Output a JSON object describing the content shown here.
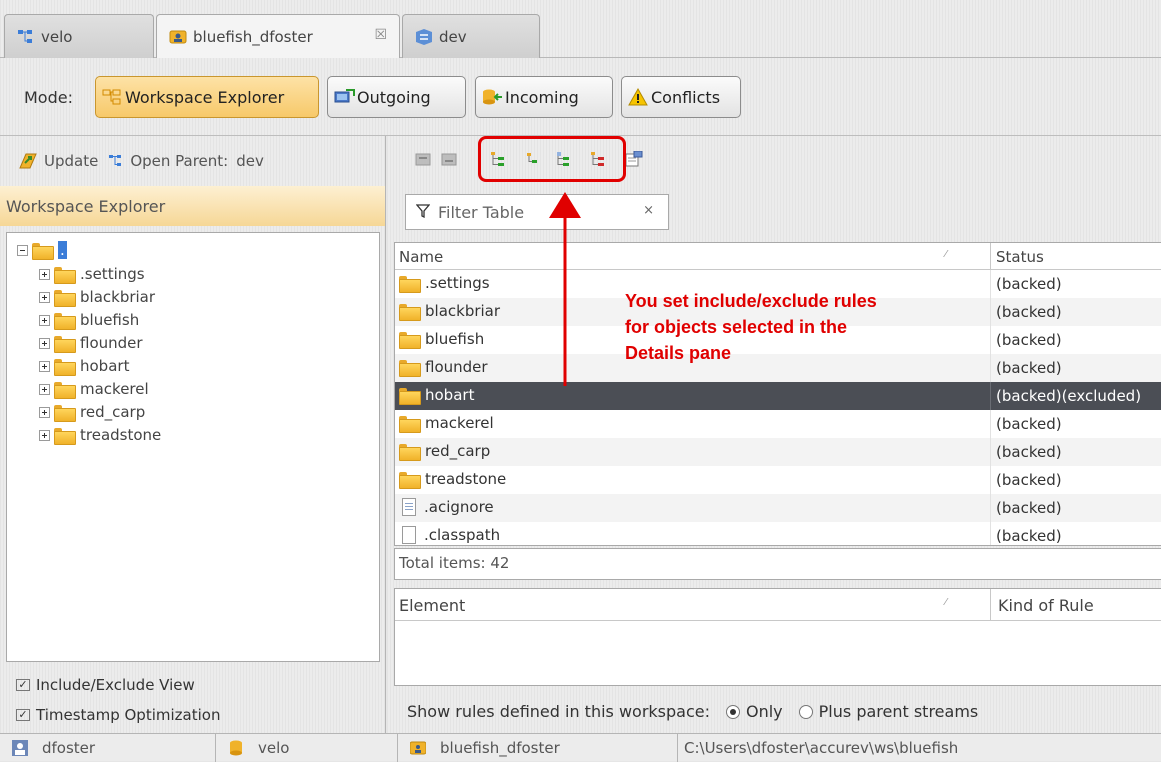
{
  "tabs": [
    {
      "label": "velo",
      "icon": "stream-tree-icon"
    },
    {
      "label": "bluefish_dfoster",
      "icon": "workspace-icon",
      "close": "☒"
    },
    {
      "label": "dev",
      "icon": "depot-stream-icon"
    }
  ],
  "mode_bar": {
    "label": "Mode:",
    "buttons": [
      {
        "label": "Workspace Explorer",
        "icon": "workspace-explorer-icon",
        "active": true
      },
      {
        "label": "Outgoing",
        "icon": "outgoing-icon"
      },
      {
        "label": "Incoming",
        "icon": "incoming-icon"
      },
      {
        "label": "Conflicts",
        "icon": "warning-icon"
      }
    ]
  },
  "left_toolbar": {
    "update_label": "Update",
    "open_parent_label": "Open Parent:",
    "parent_name": "dev"
  },
  "left_panel_title": "Workspace Explorer",
  "tree": {
    "root": ".",
    "children": [
      ".settings",
      "blackbriar",
      "bluefish",
      "flounder",
      "hobart",
      "mackerel",
      "red_carp",
      "treadstone"
    ]
  },
  "left_options": [
    {
      "label": "Include/Exclude View",
      "checked": true
    },
    {
      "label": "Timestamp Optimization",
      "checked": true
    }
  ],
  "filter": {
    "placeholder": "Filter Table",
    "clear": "×"
  },
  "details": {
    "columns": [
      "Name",
      "Status"
    ],
    "rows": [
      {
        "name": ".settings",
        "status": "(backed)",
        "type": "folder"
      },
      {
        "name": "blackbriar",
        "status": "(backed)",
        "type": "folder"
      },
      {
        "name": "bluefish",
        "status": "(backed)",
        "type": "folder"
      },
      {
        "name": "flounder",
        "status": "(backed)",
        "type": "folder"
      },
      {
        "name": "hobart",
        "status": "(backed)(excluded)",
        "type": "folder",
        "selected": true
      },
      {
        "name": "mackerel",
        "status": "(backed)",
        "type": "folder"
      },
      {
        "name": "red_carp",
        "status": "(backed)",
        "type": "folder"
      },
      {
        "name": "treadstone",
        "status": "(backed)",
        "type": "folder"
      },
      {
        "name": ".acignore",
        "status": "(backed)",
        "type": "file"
      },
      {
        "name": ".classpath",
        "status": "(backed)",
        "type": "file"
      }
    ],
    "total": "Total items: 42"
  },
  "rules_table": {
    "columns": [
      "Element",
      "Kind of Rule"
    ]
  },
  "show_rules": {
    "label": "Show rules defined in this workspace:",
    "options": [
      {
        "label": "Only",
        "selected": true
      },
      {
        "label": "Plus parent streams",
        "selected": false
      }
    ]
  },
  "annotation": "You set include/exclude rules\nfor objects selected in the\nDetails pane",
  "status_bar": [
    {
      "label": "dfoster",
      "icon": "user-icon"
    },
    {
      "label": "velo",
      "icon": "depot-icon"
    },
    {
      "label": "bluefish_dfoster",
      "icon": "workspace-icon"
    },
    {
      "label": "C:\\Users\\dfoster\\accurev\\ws\\bluefish",
      "icon": ""
    }
  ],
  "colors": {
    "accent": "#f7c96a",
    "annotation": "#e00000",
    "selected_row": "#4b4e55"
  }
}
